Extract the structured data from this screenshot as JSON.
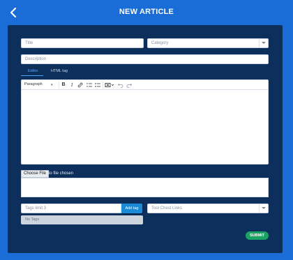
{
  "header": {
    "title": "NEW ARTICLE",
    "back_icon": "chevron-left-icon"
  },
  "form": {
    "title_placeholder": "Title",
    "category_placeholder": "Category",
    "description_placeholder": "Description",
    "tabs": [
      {
        "label": "Editor",
        "active": true
      },
      {
        "label": "HTML tag",
        "active": false
      }
    ],
    "toolbar": {
      "paragraph_label": "Paragraph",
      "bold_label": "B",
      "italic_label": "I",
      "link_icon": "link-icon",
      "bullets_icon": "bullet-list-icon",
      "numbers_icon": "numbered-list-icon",
      "media_icon": "media-icon",
      "undo_icon": "undo-icon",
      "redo_icon": "redo-icon"
    },
    "file": {
      "button_label": "Choose File",
      "status": "No file chosen"
    },
    "tags": {
      "placeholder": "Tags limit 3",
      "add_label": "Add tag",
      "empty_label": "No Tags"
    },
    "tool_chest_placeholder": "Tool Chest Links",
    "submit_label": "SUBMIT"
  },
  "colors": {
    "background": "#1a6dd6",
    "panel": "#0c2f5c",
    "accent": "#1b8bd8",
    "submit": "#1aa363"
  }
}
